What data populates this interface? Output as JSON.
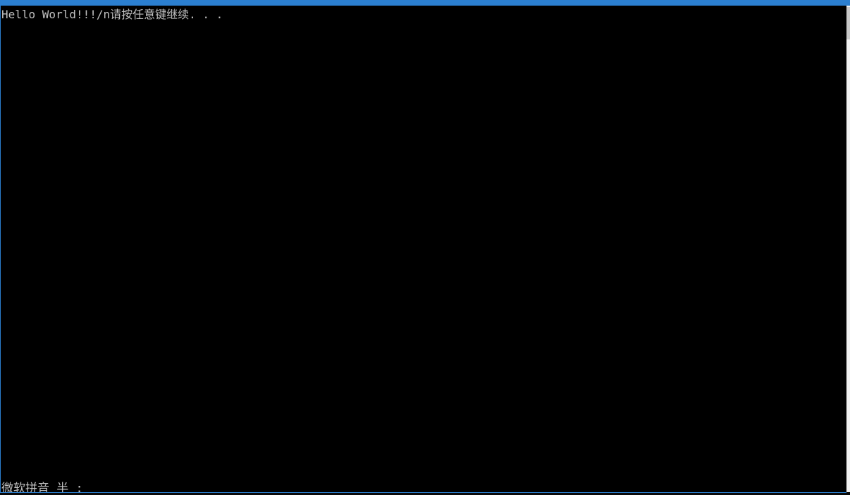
{
  "console": {
    "output_line": "Hello World!!!/n请按任意键继续. . .",
    "ime_status": "微软拼音 半 :"
  },
  "colors": {
    "background": "#000000",
    "text": "#c0c0c0",
    "accent": "#2b7fd0"
  }
}
